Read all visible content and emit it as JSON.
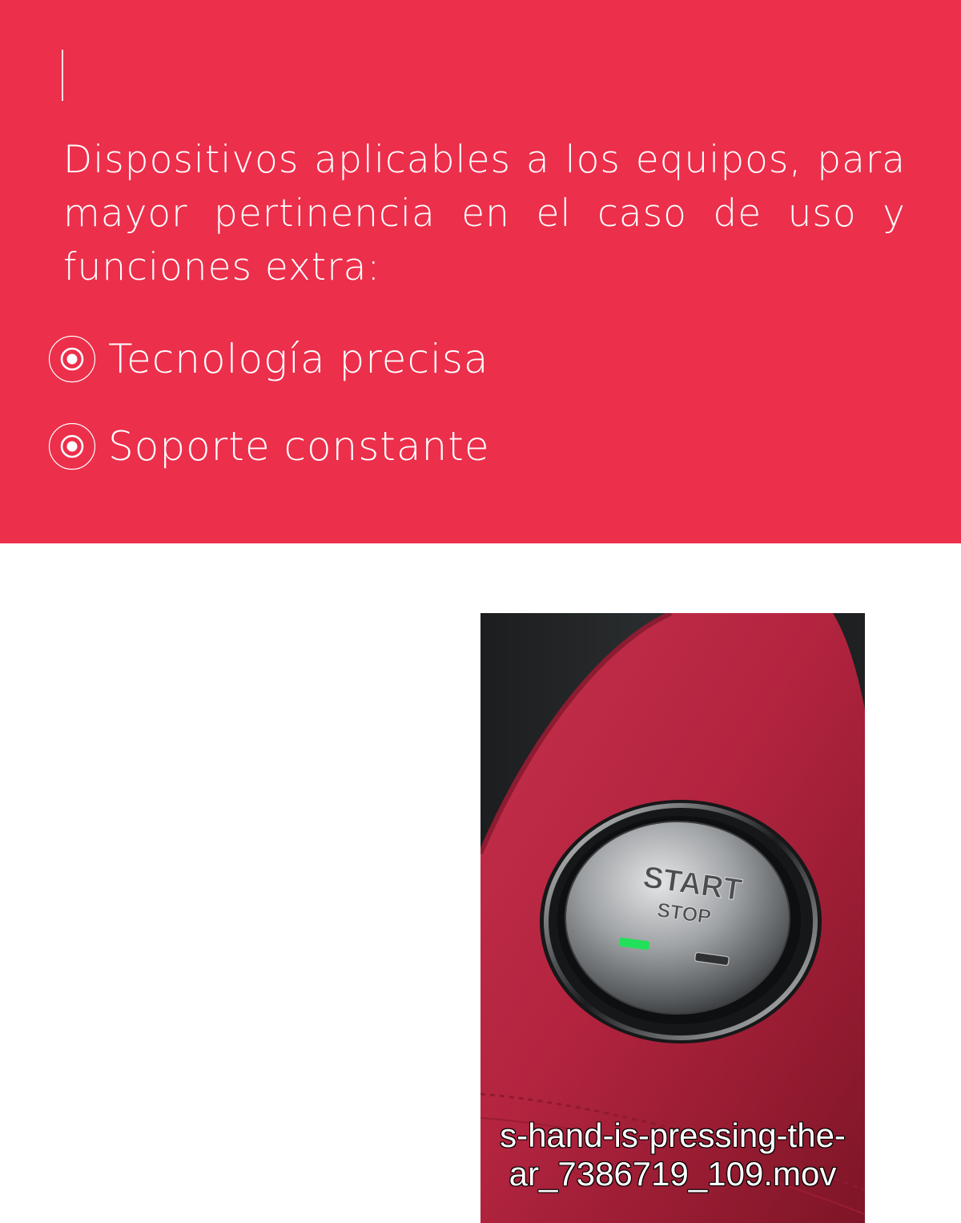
{
  "hero": {
    "intro": "Dispositivos aplicables a los equipos, para mayor pertinencia en el caso de uso y funciones extra:",
    "features": [
      {
        "label": "Tecnología precisa",
        "icon": "target-circle-icon"
      },
      {
        "label": "Soporte constante",
        "icon": "target-circle-icon"
      }
    ]
  },
  "media": {
    "button_start_label": "START",
    "button_stop_label": "STOP",
    "caption_line1": "s-hand-is-pressing-the-",
    "caption_line2": "ar_7386719_109.mov"
  },
  "colors": {
    "accent": "#ec2f4b",
    "text_on_accent": "#ffffff",
    "led_green": "#22e05a",
    "leather_red": "#b3243f"
  }
}
